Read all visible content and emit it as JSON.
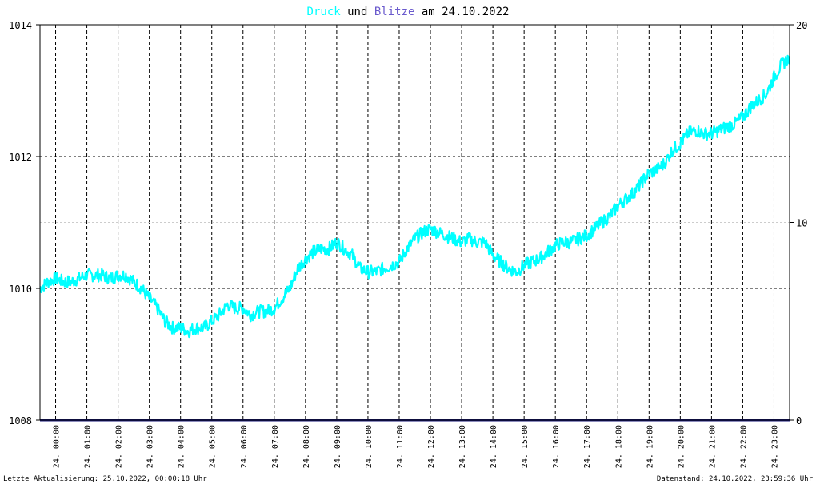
{
  "title": {
    "part1": "Druck",
    "part2": " und ",
    "part3": "Blitze",
    "part4": " am 24.10.2022"
  },
  "footer": {
    "left": "Letzte Aktualisierung: 25.10.2022, 00:00:18 Uhr",
    "right": "Datenstand: 24.10.2022, 23:59:36 Uhr"
  },
  "colors": {
    "druck": "#00ffff",
    "blitze": "#6a5acd",
    "baseline": "#1a1a7a",
    "grid": "#000000",
    "frame": "#000000",
    "text": "#000000"
  },
  "chart_data": {
    "type": "line",
    "title": "Druck und Blitze am 24.10.2022",
    "x_tick_labels": [
      "24. 00:00",
      "24. 01:00",
      "24. 02:00",
      "24. 03:00",
      "24. 04:00",
      "24. 05:00",
      "24. 06:00",
      "24. 07:00",
      "24. 08:00",
      "24. 09:00",
      "24. 10:00",
      "24. 11:00",
      "24. 12:00",
      "24. 13:00",
      "24. 14:00",
      "24. 15:00",
      "24. 16:00",
      "24. 17:00",
      "24. 18:00",
      "24. 19:00",
      "24. 20:00",
      "24. 21:00",
      "24. 22:00",
      "24. 23:00"
    ],
    "xlim_hours": [
      0,
      24
    ],
    "y_left": {
      "ylim": [
        1008,
        1014
      ],
      "ticks": [
        1008,
        1010,
        1012,
        1014
      ]
    },
    "y_right": {
      "ylim": [
        0,
        20
      ],
      "ticks": [
        0,
        10,
        20
      ]
    },
    "grid": true,
    "series": [
      {
        "name": "Druck",
        "axis": "left",
        "x_hours": [
          0.0,
          0.25,
          0.5,
          0.75,
          1.0,
          1.25,
          1.5,
          1.75,
          2.0,
          2.25,
          2.5,
          2.75,
          3.0,
          3.25,
          3.5,
          3.75,
          4.0,
          4.25,
          4.5,
          4.75,
          5.0,
          5.25,
          5.5,
          5.75,
          6.0,
          6.25,
          6.5,
          6.75,
          7.0,
          7.25,
          7.5,
          7.75,
          8.0,
          8.25,
          8.5,
          8.75,
          9.0,
          9.25,
          9.5,
          9.75,
          10.0,
          10.25,
          10.5,
          10.75,
          11.0,
          11.25,
          11.5,
          11.75,
          12.0,
          12.25,
          12.5,
          12.75,
          13.0,
          13.25,
          13.5,
          13.75,
          14.0,
          14.25,
          14.5,
          14.75,
          15.0,
          15.25,
          15.5,
          15.75,
          16.0,
          16.25,
          16.5,
          16.75,
          17.0,
          17.25,
          17.5,
          17.75,
          18.0,
          18.25,
          18.5,
          18.75,
          19.0,
          19.25,
          19.5,
          19.75,
          20.0,
          20.25,
          20.5,
          20.75,
          21.0,
          21.25,
          21.5,
          21.75,
          22.0,
          22.25,
          22.5,
          22.75,
          23.0,
          23.25,
          23.5,
          23.75,
          24.0
        ],
        "values": [
          1010.0,
          1010.1,
          1010.15,
          1010.1,
          1010.1,
          1010.15,
          1010.2,
          1010.2,
          1010.2,
          1010.15,
          1010.2,
          1010.2,
          1010.1,
          1010.0,
          1009.85,
          1009.7,
          1009.5,
          1009.4,
          1009.4,
          1009.35,
          1009.4,
          1009.4,
          1009.5,
          1009.6,
          1009.75,
          1009.7,
          1009.7,
          1009.6,
          1009.65,
          1009.65,
          1009.7,
          1009.85,
          1010.0,
          1010.3,
          1010.45,
          1010.55,
          1010.6,
          1010.6,
          1010.7,
          1010.6,
          1010.5,
          1010.3,
          1010.25,
          1010.25,
          1010.3,
          1010.35,
          1010.4,
          1010.6,
          1010.75,
          1010.85,
          1010.9,
          1010.85,
          1010.8,
          1010.75,
          1010.7,
          1010.75,
          1010.7,
          1010.7,
          1010.5,
          1010.4,
          1010.3,
          1010.25,
          1010.35,
          1010.4,
          1010.45,
          1010.55,
          1010.65,
          1010.7,
          1010.7,
          1010.75,
          1010.8,
          1010.9,
          1011.0,
          1011.1,
          1011.25,
          1011.35,
          1011.45,
          1011.6,
          1011.75,
          1011.8,
          1011.9,
          1012.1,
          1012.2,
          1012.35,
          1012.4,
          1012.35,
          1012.35,
          1012.4,
          1012.45,
          1012.5,
          1012.6,
          1012.75,
          1012.85,
          1012.95,
          1013.2,
          1013.4,
          1013.5
        ]
      },
      {
        "name": "Blitze",
        "axis": "right",
        "x_hours": [
          0,
          24
        ],
        "values": [
          0,
          0
        ]
      }
    ]
  }
}
